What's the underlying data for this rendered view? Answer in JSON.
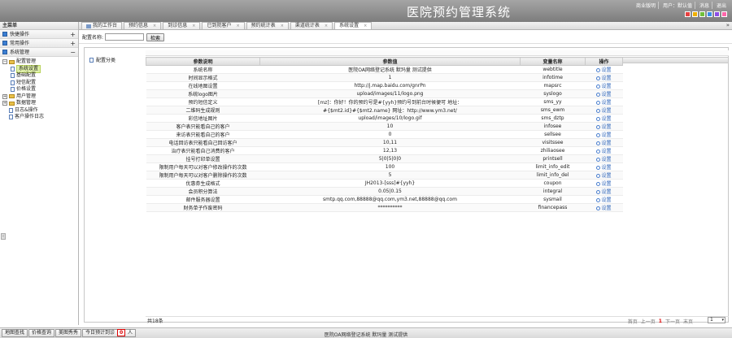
{
  "header": {
    "app_title": "医院预约管理系统",
    "links": [
      "商业版明",
      "用户：默认值",
      "消息",
      "退出"
    ],
    "skin_colors": [
      "#e64040",
      "#f0b000",
      "#6fbf3a",
      "#3a8ee6",
      "#8c4ee6",
      "#ff66aa"
    ]
  },
  "sidebar": {
    "title": "主菜单",
    "sections": [
      {
        "label": "快捷操作",
        "toggle": "+"
      },
      {
        "label": "常用操作",
        "toggle": "+"
      },
      {
        "label": "系统管理",
        "toggle": "−"
      }
    ],
    "tree": [
      {
        "label": "配置管理",
        "level": 0,
        "pm": "−",
        "type": "folder"
      },
      {
        "label": "系统设置",
        "level": 1,
        "type": "doc",
        "selected": true
      },
      {
        "label": "基础配置",
        "level": 1,
        "type": "doc"
      },
      {
        "label": "短信配置",
        "level": 1,
        "type": "doc"
      },
      {
        "label": "价格设置",
        "level": 1,
        "type": "doc"
      },
      {
        "label": "用户管理",
        "level": 0,
        "pm": "+",
        "type": "folder"
      },
      {
        "label": "数据管理",
        "level": 0,
        "pm": "+",
        "type": "folder"
      },
      {
        "label": "日志&操作",
        "level": 0,
        "type": "doc"
      },
      {
        "label": "客户操作日志",
        "level": 0,
        "type": "doc"
      }
    ],
    "collapse_glyph": "‹"
  },
  "tabs": [
    {
      "label": "我的工作台",
      "home": true
    },
    {
      "label": "预约信息"
    },
    {
      "label": "到诊信息"
    },
    {
      "label": "已到院客户"
    },
    {
      "label": "预约统计表"
    },
    {
      "label": "渠道统计表"
    },
    {
      "label": "系统设置",
      "active": true
    }
  ],
  "tab_close": "×",
  "tab_more": "»",
  "toolbar": {
    "label": "配置名称:",
    "search_value": "",
    "search_button": "检索"
  },
  "config_tree": {
    "label": "配置分类"
  },
  "grid": {
    "columns": [
      "参数说明",
      "参数值",
      "变量名称",
      "操作"
    ],
    "op_label": "设置",
    "rows": [
      [
        "系统名称",
        "医院OA网络登记系统 默玛量 测试提供",
        "webtitle"
      ],
      [
        "时间显示格式",
        "1",
        "infotime"
      ],
      [
        "在线地图设置",
        "http://j.map.baidu.com/gnrPn",
        "mapsrc"
      ],
      [
        "系统logo图片",
        "upload/images/11/logo.png",
        "syslogo"
      ],
      [
        "预约短信定义",
        "[mz]：你好！你的预约号是#{yyh}预约号到前台时候便可 地址：",
        "sms_yy"
      ],
      [
        "二维码生成规则",
        "#{$mt2.id}#{$mt2.name} 网址：http://www.ym3.net/",
        "sms_ewm"
      ],
      [
        "彩信地址图片",
        "upload/images/10/logo.gif",
        "sms_dztp"
      ],
      [
        "客户表只能看自己的客户",
        "10",
        "infosee"
      ],
      [
        "来访表只能看自己的客户",
        "0",
        "sellsee"
      ],
      [
        "电话回访表只能看自己回访客户",
        "10,11",
        "visitssee"
      ],
      [
        "治疗表只能看自己消费的客户",
        "12,13",
        "zhiliaosee"
      ],
      [
        "挂号打印单设置",
        "5|0|5|0|0",
        "printsell"
      ],
      [
        "限制用户每天可以对客户修改操作的次数",
        "100",
        "limit_info_edit"
      ],
      [
        "限制用户每天可以对客户删除操作的次数",
        "5",
        "limit_info_del"
      ],
      [
        "优惠券生成格式",
        "JH2013-[sss]#{yyh}",
        "coupon"
      ],
      [
        "会员积分算法",
        "0.05|0.15",
        "integral"
      ],
      [
        "邮件服务器设置",
        "smtp.qq.com,88888@qq.com,ym3.net,88888@qq.com",
        "sysmail"
      ],
      [
        "财务单子作废密码",
        "**********",
        "financepass"
      ]
    ]
  },
  "pager": {
    "count_label": "共18条",
    "first": "首页",
    "prev": "上一页",
    "current": "1",
    "next": "下一页",
    "last": "末页",
    "page_select": "1"
  },
  "statusbar": {
    "buttons": [
      "地图查找",
      "价格查询",
      "美图秀秀"
    ],
    "today_label_pre": "今日预计到诊",
    "today_count": "0",
    "today_label_post": "人",
    "center_text": "医院OA网络登记系统 默玛量 测试提供"
  }
}
